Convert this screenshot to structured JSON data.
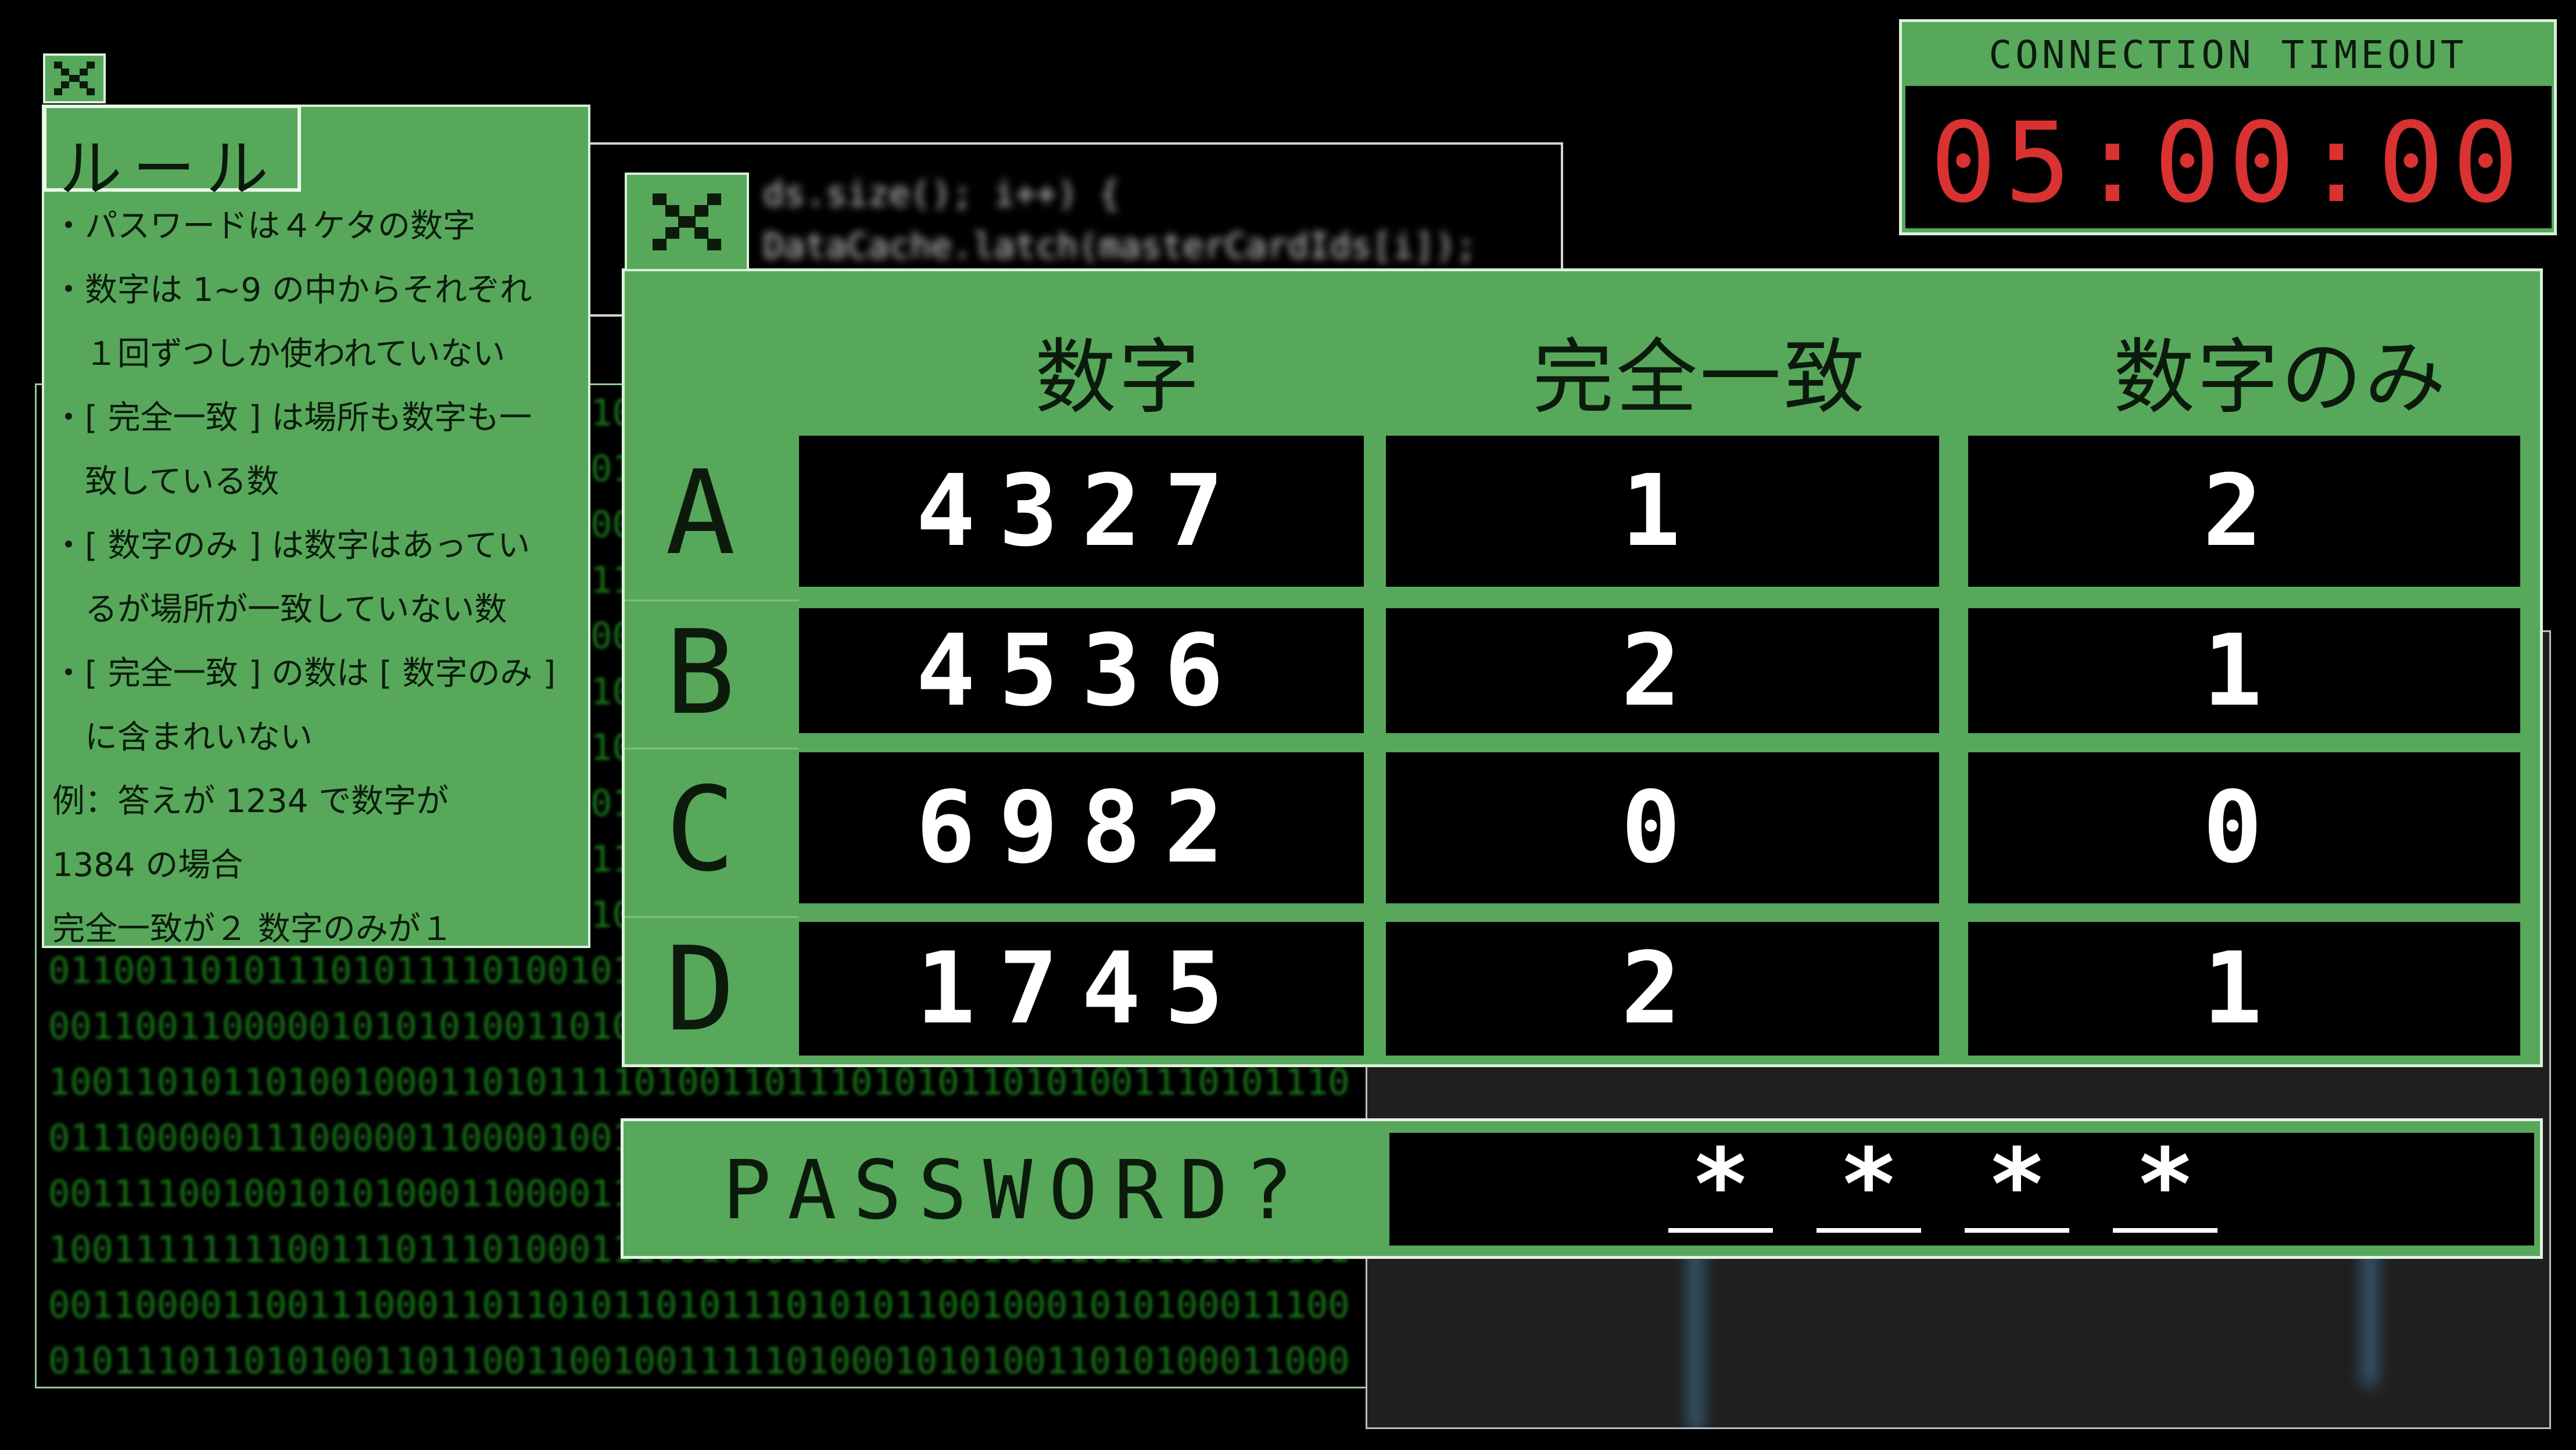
{
  "timeout": {
    "label": "CONNECTION TIMEOUT",
    "value": "05:00:00"
  },
  "rules": {
    "title": "ルール",
    "lines": [
      "・パスワードは４ケタの数字",
      "・数字は 1~9 の中からそれぞれ",
      "　１回ずつしか使われていない",
      "・[ 完全一致 ] は場所も数字も一",
      "　致している数",
      "・[ 数字のみ ] は数字はあってい",
      "　るが場所が一致していない数",
      "・[ 完全一致 ] の数は [ 数字のみ ]",
      "　に含まれいない",
      "例：答えが 1234 で数字が",
      "1384 の場合",
      "完全一致が２ 数字のみが１"
    ]
  },
  "hint_table": {
    "headers": [
      "数字",
      "完全一致",
      "数字のみ"
    ],
    "rows": [
      {
        "label": "A",
        "number": "4327",
        "exact": "1",
        "numbers_only": "2"
      },
      {
        "label": "B",
        "number": "4536",
        "exact": "2",
        "numbers_only": "1"
      },
      {
        "label": "C",
        "number": "6982",
        "exact": "0",
        "numbers_only": "0"
      },
      {
        "label": "D",
        "number": "1745",
        "exact": "2",
        "numbers_only": "1"
      }
    ]
  },
  "password": {
    "label": "PASSWORD?",
    "chars": [
      "*",
      "*",
      "*",
      "*"
    ]
  },
  "colors": {
    "panel_green": "#57a85b",
    "timer_red": "#d83232",
    "matrix_green": "#1f8a1f"
  },
  "icons": {
    "close": "close-icon"
  }
}
